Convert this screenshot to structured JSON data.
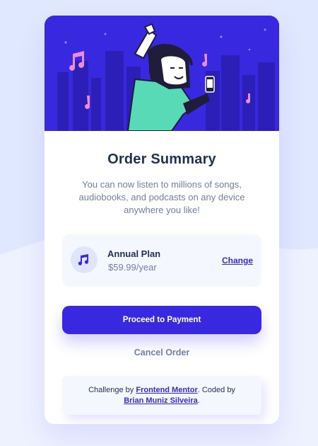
{
  "page": {
    "background_color": "#e0e8ff",
    "wave_color": "#eef2ff"
  },
  "hero": {
    "background_color": "#3829e0",
    "illustration": "dancing-person-with-headphones-illustration"
  },
  "order": {
    "title": "Order Summary",
    "description": "You can now listen to millions of songs, audiobooks, and podcasts on any device anywhere you like!"
  },
  "plan": {
    "icon": "music-note-icon",
    "name": "Annual Plan",
    "price": "$59.99/year",
    "change_label": "Change"
  },
  "actions": {
    "pay_label": "Proceed to Payment",
    "cancel_label": "Cancel Order"
  },
  "attribution": {
    "prefix": "Challenge by ",
    "challenge_link": "Frontend Mentor",
    "middle": ". Coded by ",
    "author_link": "Brian Muniz Silveira",
    "suffix": "."
  },
  "colors": {
    "accent": "#3829e0",
    "heading": "#1f2f56",
    "muted": "#717fa6",
    "panel": "#f5f7ff"
  }
}
